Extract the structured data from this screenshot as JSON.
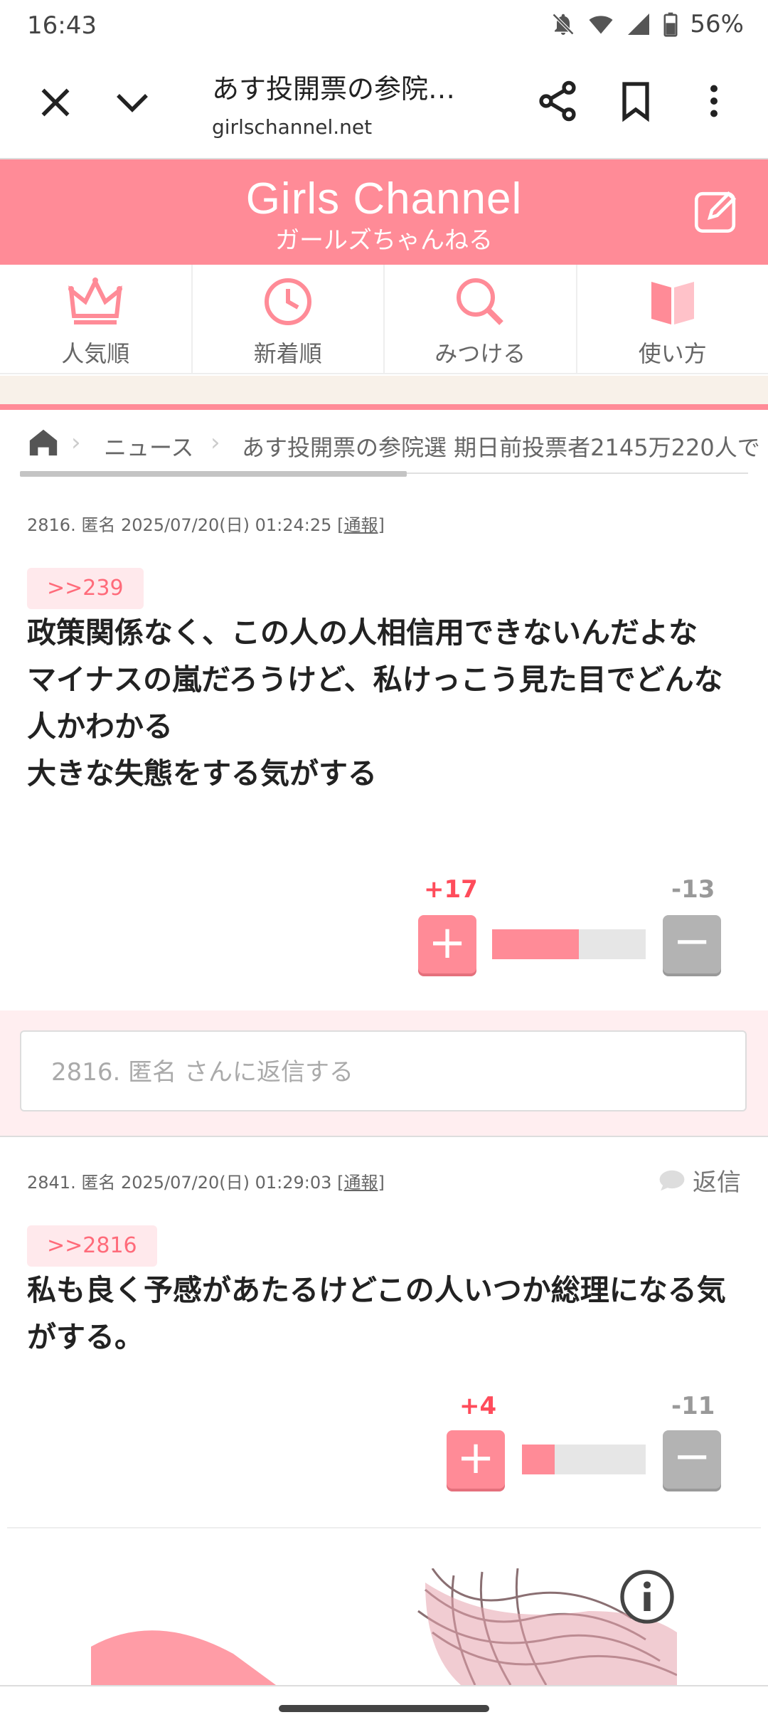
{
  "status": {
    "time": "16:43",
    "battery": "56%"
  },
  "browser": {
    "title": "あす投開票の参院…",
    "url": "girlschannel.net"
  },
  "brand": {
    "logo": "Girls Channel",
    "sub": "ガールズちゃんねる"
  },
  "nav": [
    {
      "label": "人気順",
      "icon": "crown-icon"
    },
    {
      "label": "新着順",
      "icon": "clock-icon"
    },
    {
      "label": "みつける",
      "icon": "search-icon"
    },
    {
      "label": "使い方",
      "icon": "book-icon"
    }
  ],
  "breadcrumb": {
    "crumb1": "ニュース",
    "crumb2": "あす投開票の参院選 期日前投票者2145万220人で"
  },
  "comments": [
    {
      "meta": "2816. 匿名 2025/07/20(日) 01:24:25",
      "report": "[通報]",
      "anchor": ">>239",
      "body": "政策関係なく、この人の人相信用できないんだよな\nマイナスの嵐だろうけど、私けっこう見た目でどんな人かわかる\n大きな失態をする気がする",
      "plus": "+17",
      "minus": "-13",
      "plus_ratio": 0.567
    },
    {
      "meta": "2841. 匿名 2025/07/20(日) 01:29:03",
      "report": "[通報]",
      "reply": "返信",
      "anchor": ">>2816",
      "body": "私も良く予感があたるけどこの人いつか総理になる気がする。",
      "plus": "+4",
      "minus": "-11",
      "plus_ratio": 0.267
    }
  ],
  "reply_box": {
    "placeholder": "2816. 匿名 さんに返信する"
  },
  "colors": {
    "brand": "#ff8b97",
    "plus": "#ff4c5b"
  }
}
